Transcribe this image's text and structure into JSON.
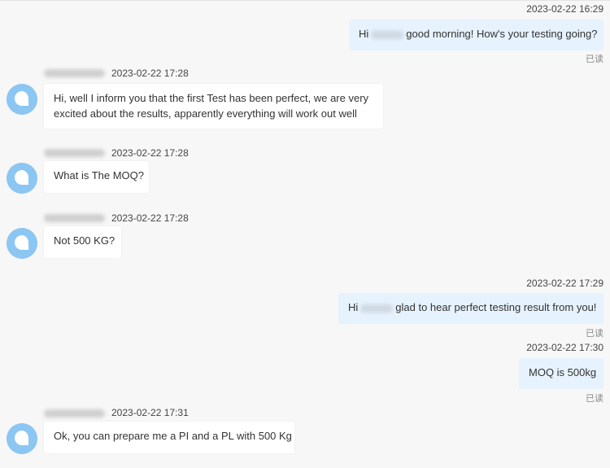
{
  "conversation": {
    "read_label": "已读",
    "messages": [
      {
        "direction": "outgoing",
        "time": "2023-02-22 16:29",
        "text_before": "Hi",
        "text_after": "good morning! How's your testing going?",
        "status": "已读"
      },
      {
        "direction": "incoming",
        "time": "2023-02-22 17:28",
        "line1": "Hi, well I inform you that the first Test has been perfect, we are very",
        "line2": "excited about the results, apparently everything will work out well"
      },
      {
        "direction": "incoming",
        "time": "2023-02-22 17:28",
        "text": "What is The MOQ?"
      },
      {
        "direction": "incoming",
        "time": "2023-02-22 17:28",
        "text": "Not 500 KG?"
      },
      {
        "direction": "outgoing",
        "time": "2023-02-22 17:29",
        "text_before": "Hi",
        "text_after": "glad to hear perfect testing result from you!",
        "status": "已读"
      },
      {
        "direction": "outgoing",
        "time": "2023-02-22 17:30",
        "text": "MOQ is 500kg",
        "status": "已读"
      },
      {
        "direction": "incoming",
        "time": "2023-02-22 17:31",
        "text": "Ok, you can prepare me a PI and a PL with 500 Kg"
      }
    ]
  },
  "colors": {
    "background": "#f7f7f7",
    "outgoing_bubble": "#e6f2fd",
    "incoming_bubble": "#ffffff",
    "avatar": "#8cc6f2"
  }
}
